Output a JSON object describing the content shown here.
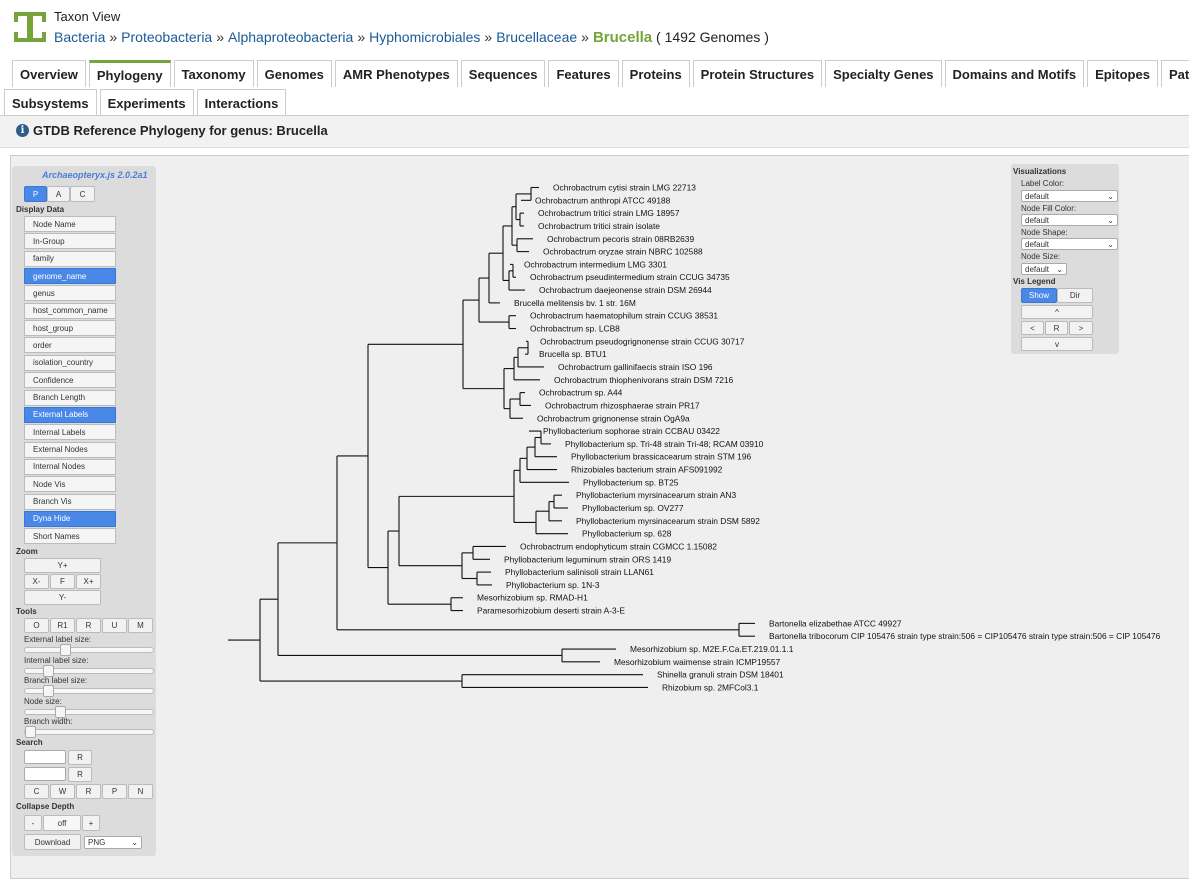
{
  "header": {
    "page_title": "Taxon View",
    "breadcrumbs": [
      "Bacteria",
      "Proteobacteria",
      "Alphaproteobacteria",
      "Hyphomicrobiales",
      "Brucellaceae"
    ],
    "current_taxon": "Brucella",
    "genome_count": "( 1492 Genomes )",
    "separator": "»"
  },
  "tabs_row1": [
    "Overview",
    "Phylogeny",
    "Taxonomy",
    "Genomes",
    "AMR Phenotypes",
    "Sequences",
    "Features",
    "Proteins",
    "Protein Structures",
    "Specialty Genes",
    "Domains and Motifs",
    "Epitopes",
    "Pathways"
  ],
  "tabs_row2": [
    "Subsystems",
    "Experiments",
    "Interactions"
  ],
  "active_tab": "Phylogeny",
  "panel_header": {
    "info_icon": "i",
    "title": "GTDB Reference Phylogeny for genus: Brucella"
  },
  "controls": {
    "app_version": "Archaeopteryx.js 2.0.2a1",
    "mode_buttons": [
      "P",
      "A",
      "C"
    ],
    "display_data_label": "Display Data",
    "display_items": [
      {
        "label": "Node Name",
        "selected": false
      },
      {
        "label": "In-Group",
        "selected": false
      },
      {
        "label": "family",
        "selected": false
      },
      {
        "label": "genome_name",
        "selected": true
      },
      {
        "label": "genus",
        "selected": false
      },
      {
        "label": "host_common_name",
        "selected": false
      },
      {
        "label": "host_group",
        "selected": false
      },
      {
        "label": "order",
        "selected": false
      },
      {
        "label": "isolation_country",
        "selected": false
      },
      {
        "label": "Confidence",
        "selected": false
      },
      {
        "label": "Branch Length",
        "selected": false
      },
      {
        "label": "External Labels",
        "selected": true
      },
      {
        "label": "Internal Labels",
        "selected": false
      },
      {
        "label": "External Nodes",
        "selected": false
      },
      {
        "label": "Internal Nodes",
        "selected": false
      },
      {
        "label": "Node Vis",
        "selected": false
      },
      {
        "label": "Branch Vis",
        "selected": false
      },
      {
        "label": "Dyna Hide",
        "selected": true
      },
      {
        "label": "Short Names",
        "selected": false
      }
    ],
    "zoom_label": "Zoom",
    "zoom": {
      "y_plus": "Y+",
      "x_minus": "X-",
      "fit": "F",
      "x_plus": "X+",
      "y_minus": "Y-"
    },
    "tools_label": "Tools",
    "tools": [
      "O",
      "R1",
      "R",
      "U",
      "M"
    ],
    "sliders": [
      {
        "label": "External label size:",
        "level": 0.3
      },
      {
        "label": "Internal label size:",
        "level": 0.15
      },
      {
        "label": "Branch label size:",
        "level": 0.15
      },
      {
        "label": "Node size:",
        "level": 0.25
      },
      {
        "label": "Branch width:",
        "level": 0.0
      }
    ],
    "search_label": "Search",
    "search_reset": "R",
    "search_buttons": [
      "C",
      "W",
      "R",
      "P",
      "N"
    ],
    "collapse_label": "Collapse Depth",
    "collapse": {
      "minus": "-",
      "value": "off",
      "plus": "+"
    },
    "download_label": "Download",
    "download_format": "PNG"
  },
  "visualizations": {
    "title": "Visualizations",
    "label_color": {
      "label": "Label Color:",
      "value": "default"
    },
    "node_fill_color": {
      "label": "Node Fill Color:",
      "value": "default"
    },
    "node_shape": {
      "label": "Node Shape:",
      "value": "default"
    },
    "node_size": {
      "label": "Node Size:",
      "value": "default"
    },
    "vis_legend": "Vis Legend",
    "show": "Show",
    "dir": "Dir",
    "arrows": {
      "up": "^",
      "left": "<",
      "reset": "R",
      "right": ">",
      "down": "v"
    }
  },
  "tree": {
    "leaves": [
      "Ochrobactrum cytisi strain LMG 22713",
      "Ochrobactrum anthropi ATCC 49188",
      "Ochrobactrum tritici strain LMG 18957",
      "Ochrobactrum tritici strain isolate",
      "Ochrobactrum pecoris strain 08RB2639",
      "Ochrobactrum oryzae strain NBRC 102588",
      "Ochrobactrum intermedium LMG 3301",
      "Ochrobactrum pseudintermedium strain CCUG 34735",
      "Ochrobactrum daejeonense strain DSM 26944",
      "Brucella melitensis bv. 1 str. 16M",
      "Ochrobactrum haematophilum strain CCUG 38531",
      "Ochrobactrum sp. LCB8",
      "Ochrobactrum pseudogrignonense strain CCUG 30717",
      "Brucella sp. BTU1",
      "Ochrobactrum gallinifaecis strain ISO 196",
      "Ochrobactrum thiophenivorans strain DSM 7216",
      "Ochrobactrum sp. A44",
      "Ochrobactrum rhizosphaerae strain PR17",
      "Ochrobactrum grignonense strain OgA9a",
      "Phyllobacterium sophorae strain CCBAU 03422",
      "Phyllobacterium sp. Tri-48 strain Tri-48; RCAM 03910",
      "Phyllobacterium brassicacearum strain STM 196",
      "Rhizobiales bacterium strain AFS091992",
      "Phyllobacterium sp. BT25",
      "Phyllobacterium myrsinacearum strain AN3",
      "Phyllobacterium sp. OV277",
      "Phyllobacterium myrsinacearum strain DSM 5892",
      "Phyllobacterium sp. 628",
      "Ochrobactrum endophyticum strain CGMCC 1.15082",
      "Phyllobacterium leguminum strain ORS 1419",
      "Phyllobacterium salinisoli strain LLAN61",
      "Phyllobacterium sp. 1N-3",
      "Mesorhizobium sp. RMAD-H1",
      "Paramesorhizobium deserti strain A-3-E",
      "Bartonella elizabethae ATCC 49927",
      "Bartonella tribocorum CIP 105476 strain type strain:506 = CIP105476 strain type strain:506 = CIP 105476",
      "Mesorhizobium sp. M2E.F.Ca.ET.219.01.1.1",
      "Mesorhizobium waimense strain ICMP19557",
      "Shinella granuli strain DSM 18401",
      "Rhizobium sp. 2MFCol3.1"
    ]
  }
}
